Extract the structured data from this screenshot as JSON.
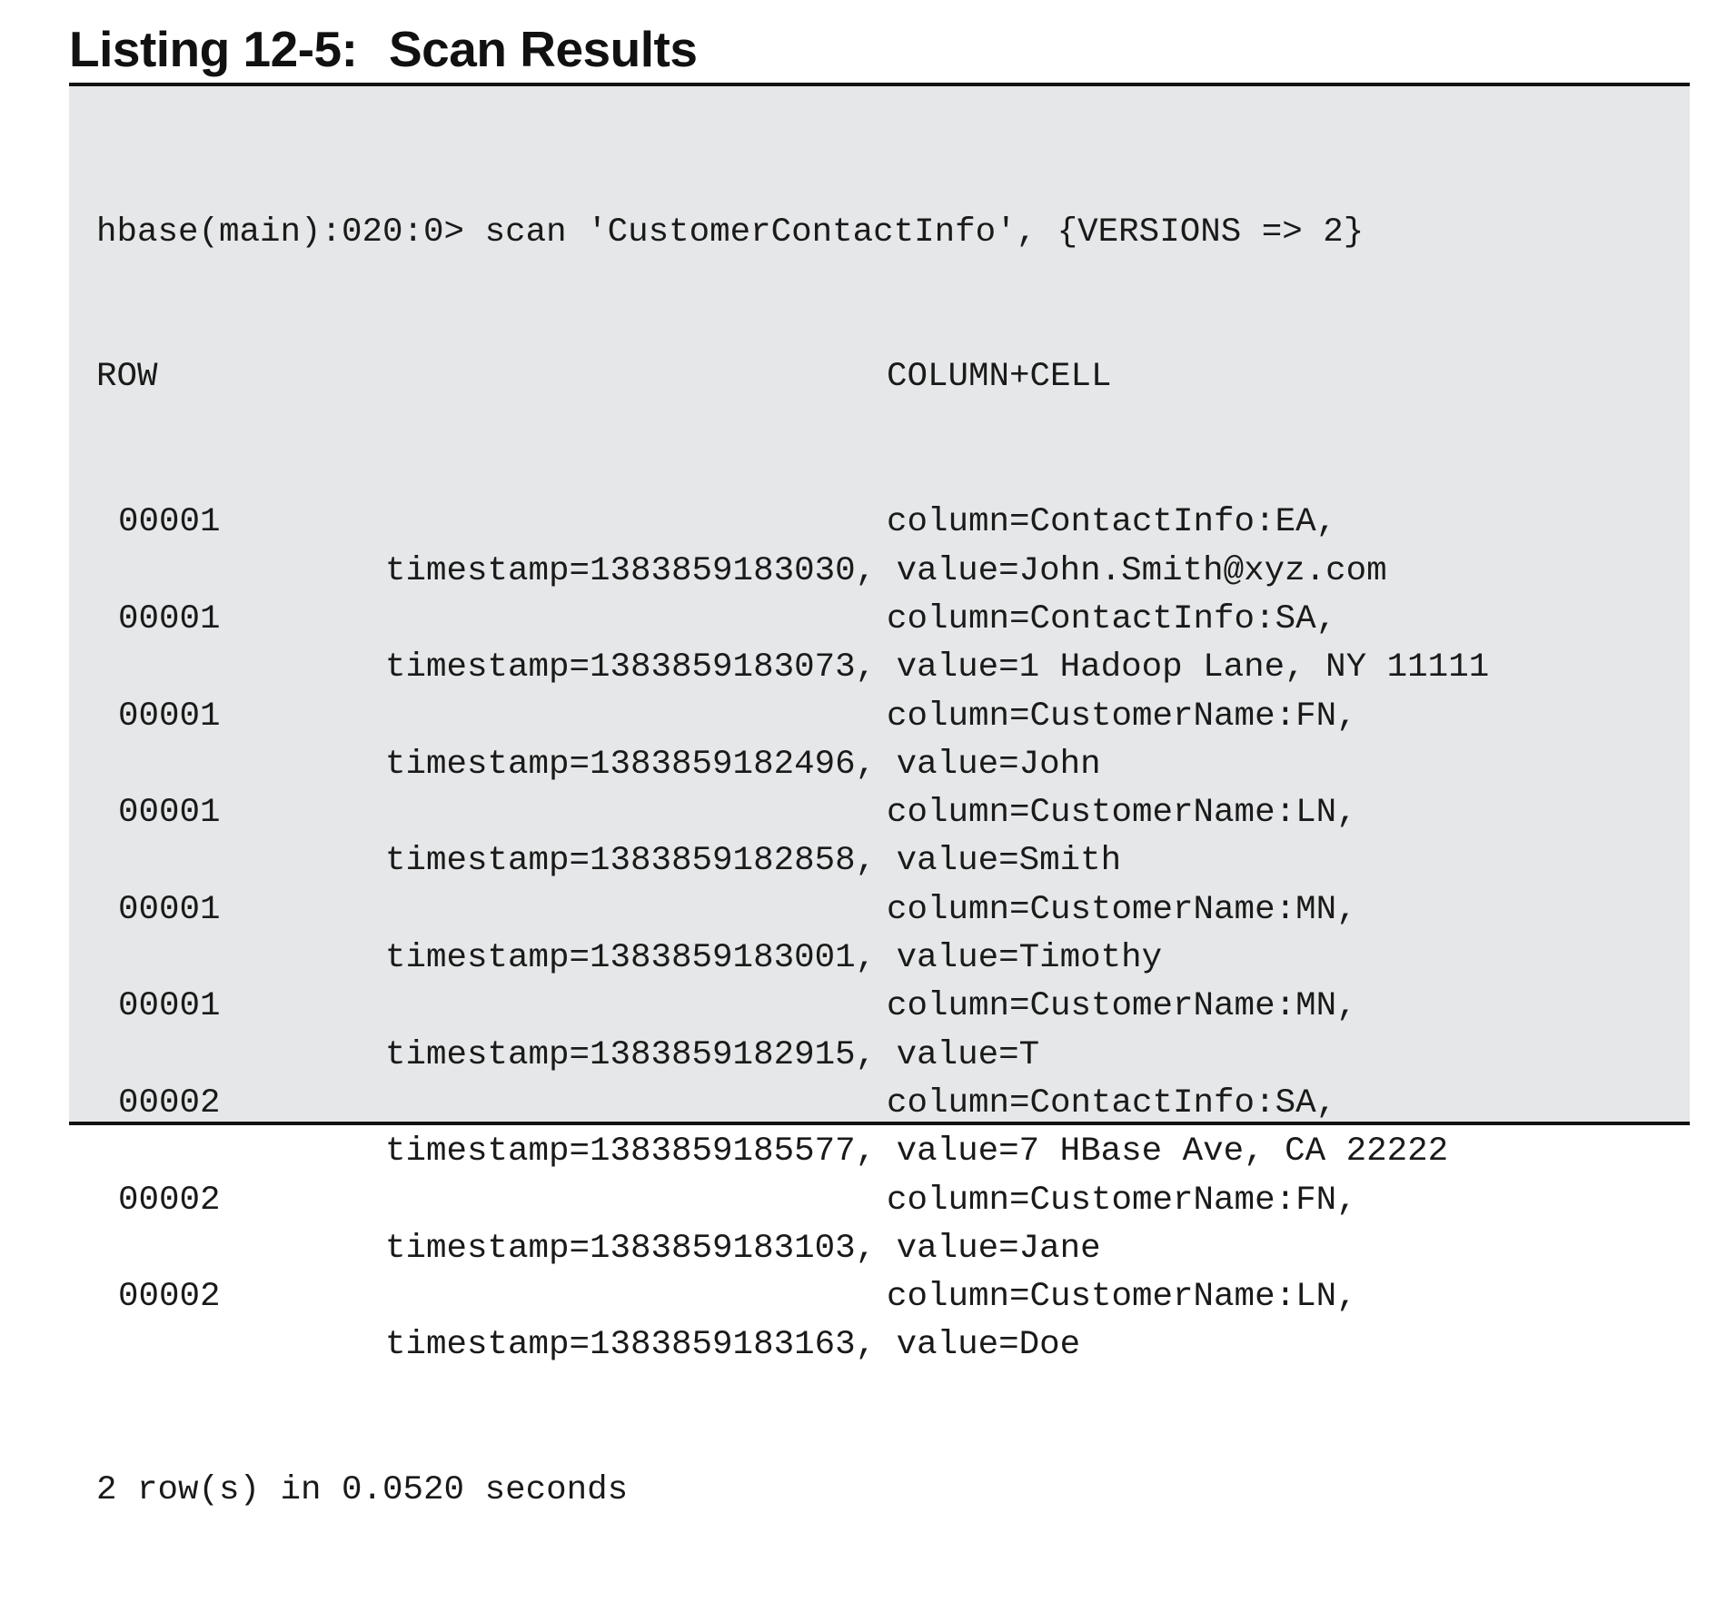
{
  "listing": {
    "number": "Listing 12-5:",
    "title": "Scan Results"
  },
  "code": {
    "command": "hbase(main):020:0> scan 'CustomerContactInfo', {VERSIONS => 2}",
    "header": {
      "row": "ROW",
      "column_cell": "COLUMN+CELL"
    },
    "entries": [
      {
        "row": "00001",
        "column": "column=ContactInfo:EA,",
        "detail": "timestamp=1383859183030, value=John.Smith@xyz.com"
      },
      {
        "row": "00001",
        "column": "column=ContactInfo:SA,",
        "detail": "timestamp=1383859183073, value=1 Hadoop Lane, NY 11111"
      },
      {
        "row": "00001",
        "column": "column=CustomerName:FN,",
        "detail": "timestamp=1383859182496, value=John"
      },
      {
        "row": "00001",
        "column": "column=CustomerName:LN,",
        "detail": "timestamp=1383859182858, value=Smith"
      },
      {
        "row": "00001",
        "column": "column=CustomerName:MN,",
        "detail": "timestamp=1383859183001, value=Timothy"
      },
      {
        "row": "00001",
        "column": "column=CustomerName:MN,",
        "detail": "timestamp=1383859182915, value=T"
      },
      {
        "row": "00002",
        "column": "column=ContactInfo:SA,",
        "detail": "timestamp=1383859185577, value=7 HBase Ave, CA 22222"
      },
      {
        "row": "00002",
        "column": "column=CustomerName:FN,",
        "detail": "timestamp=1383859183103, value=Jane"
      },
      {
        "row": "00002",
        "column": "column=CustomerName:LN,",
        "detail": "timestamp=1383859183163, value=Doe"
      }
    ],
    "summary": "2 row(s) in 0.0520 seconds"
  }
}
